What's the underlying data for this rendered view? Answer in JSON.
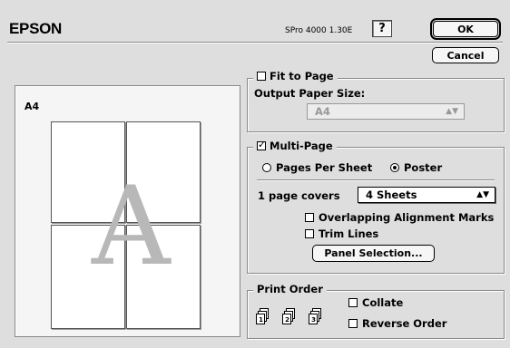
{
  "header": {
    "brand": "EPSON",
    "version": "SPro 4000 1.30E",
    "help_label": "?",
    "ok_label": "OK",
    "cancel_label": "Cancel"
  },
  "preview": {
    "paper_label": "A4",
    "poster_letter": "A"
  },
  "fit_to_page": {
    "label": "Fit to Page",
    "checked": false,
    "output_size_label": "Output Paper Size:",
    "output_size_value": "A4"
  },
  "multi_page": {
    "label": "Multi-Page",
    "checked": true,
    "pages_per_sheet_label": "Pages Per Sheet",
    "poster_label": "Poster",
    "selected": "Poster",
    "covers_label": "1 page covers",
    "covers_value": "4 Sheets",
    "overlap_label": "Overlapping Alignment Marks",
    "overlap_checked": false,
    "trim_label": "Trim Lines",
    "trim_checked": false,
    "panel_selection_label": "Panel Selection..."
  },
  "print_order": {
    "label": "Print Order",
    "collate_label": "Collate",
    "collate_checked": false,
    "reverse_label": "Reverse Order",
    "reverse_checked": false,
    "icons": [
      "collate-order-icon-1",
      "collate-order-icon-2",
      "collate-order-icon-3"
    ]
  }
}
